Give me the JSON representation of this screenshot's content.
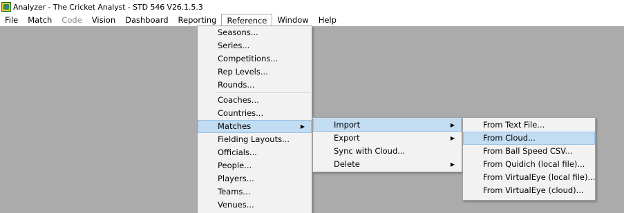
{
  "window": {
    "title": "Analyzer - The Cricket Analyst - STD 546 V26.1.5.3"
  },
  "menubar": {
    "items": [
      {
        "label": "File"
      },
      {
        "label": "Match"
      },
      {
        "label": "Code",
        "disabled": true
      },
      {
        "label": "Vision"
      },
      {
        "label": "Dashboard"
      },
      {
        "label": "Reporting"
      },
      {
        "label": "Reference",
        "open": true
      },
      {
        "label": "Window"
      },
      {
        "label": "Help"
      }
    ]
  },
  "reference_menu": {
    "items": [
      {
        "label": "Seasons..."
      },
      {
        "label": "Series..."
      },
      {
        "label": "Competitions..."
      },
      {
        "label": "Rep Levels..."
      },
      {
        "label": "Rounds..."
      },
      {
        "label": "Coaches..."
      },
      {
        "label": "Countries..."
      },
      {
        "label": "Matches",
        "submenu": true,
        "highlighted": true
      },
      {
        "label": "Fielding Layouts..."
      },
      {
        "label": "Officials..."
      },
      {
        "label": "People..."
      },
      {
        "label": "Players..."
      },
      {
        "label": "Teams..."
      },
      {
        "label": "Venues..."
      }
    ]
  },
  "matches_submenu": {
    "items": [
      {
        "label": "Import",
        "submenu": true,
        "highlighted": true
      },
      {
        "label": "Export",
        "submenu": true
      },
      {
        "label": "Sync with Cloud..."
      },
      {
        "label": "Delete",
        "submenu": true
      }
    ]
  },
  "import_submenu": {
    "items": [
      {
        "label": "From Text File..."
      },
      {
        "label": "From Cloud...",
        "highlighted": true
      },
      {
        "label": "From Ball Speed CSV..."
      },
      {
        "label": "From Quidich (local file)..."
      },
      {
        "label": "From VirtualEye (local file)..."
      },
      {
        "label": "From VirtualEye (cloud)..."
      }
    ]
  },
  "colors": {
    "workspace": "#ababab",
    "menu_background": "#f2f2f2",
    "highlight": "#c2dcf2"
  },
  "icons": {
    "app": "cricket-analyst-app-icon",
    "submenu_arrow": "▶"
  }
}
